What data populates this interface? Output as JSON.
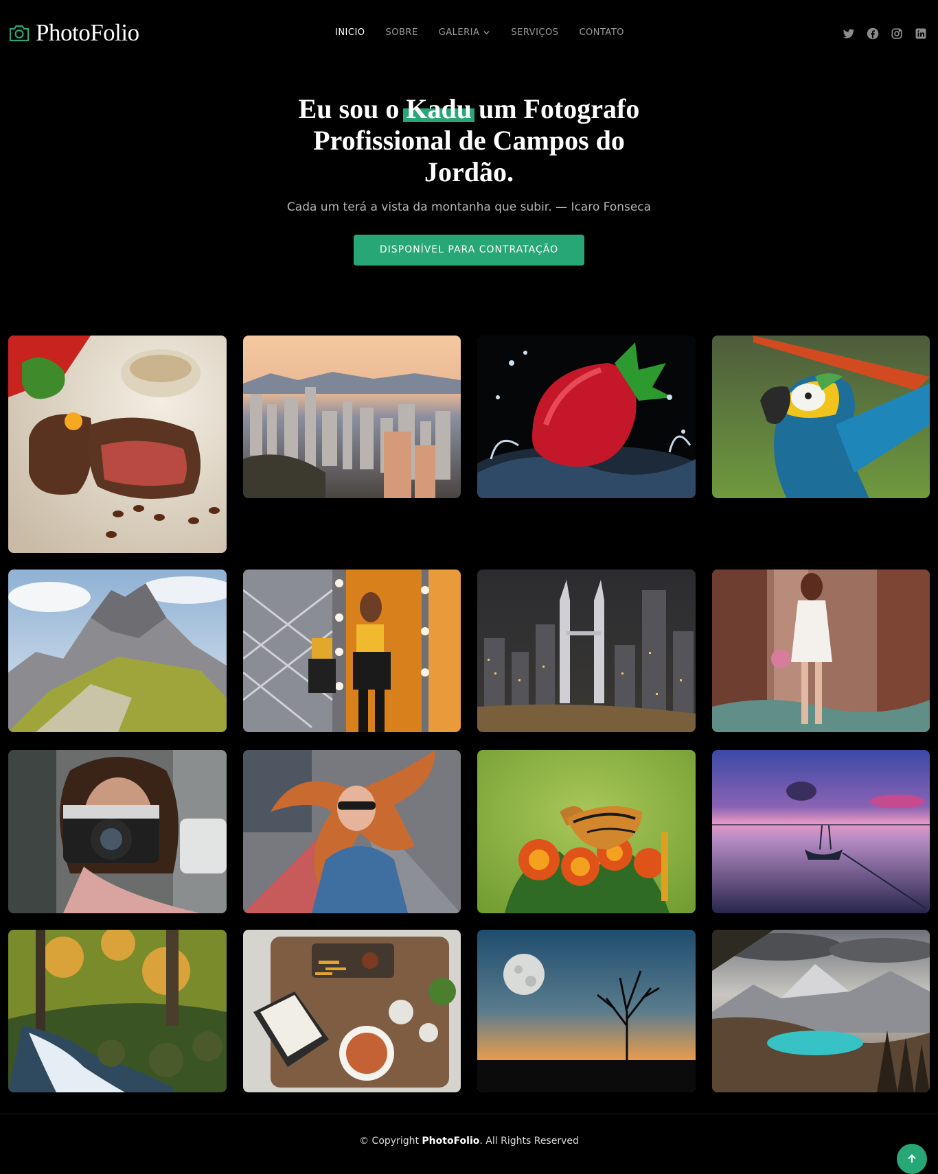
{
  "brand": {
    "name": "PhotoFolio",
    "accent": "#27a776"
  },
  "nav": {
    "items": [
      {
        "label": "Inicio",
        "active": true
      },
      {
        "label": "Sobre"
      },
      {
        "label": "Galeria",
        "has_dropdown": true
      },
      {
        "label": "Serviços"
      },
      {
        "label": "Contato"
      }
    ]
  },
  "social": [
    "twitter-icon",
    "facebook-icon",
    "instagram-icon",
    "linkedin-icon"
  ],
  "hero": {
    "title_before": "Eu sou o ",
    "title_highlight": "Kadu",
    "title_after": " um Fotografo Profissional de Campos do Jordão.",
    "subtitle": "Cada um terá a vista da montanha que subir. — Icaro Fonseca",
    "cta_label": "DISPONÍVEL PARA CONTRATAÇÃO"
  },
  "gallery": {
    "items": [
      "steak-photo",
      "city-skyline-photo",
      "strawberry-splash-photo",
      "macaw-photo",
      "mountain-peak-photo",
      "mirror-models-photo",
      "petronas-towers-photo",
      "forest-girl-photo",
      "woman-camera-photo",
      "windblown-hair-photo",
      "butterfly-photo",
      "lake-boat-sunset-photo",
      "waterfall-forest-photo",
      "food-table-photo",
      "moon-tree-sunset-photo",
      "mountain-lake-photo"
    ]
  },
  "footer": {
    "prefix": "© Copyright ",
    "brand": "PhotoFolio",
    "suffix": ". All Rights Reserved"
  }
}
